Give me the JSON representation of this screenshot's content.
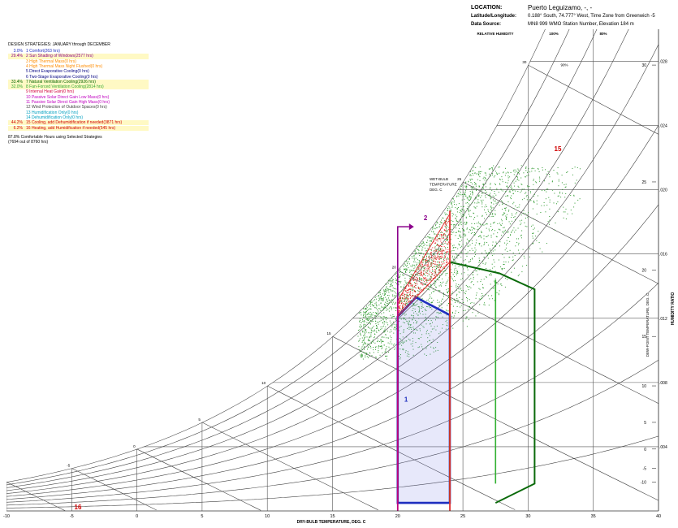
{
  "header": {
    "location_label": "LOCATION:",
    "location_value": "Puerto Leguizamo, -, -",
    "latlon_label": "Latitude/Longitude:",
    "latlon_value": "0.188° South, 74.777° West, Time Zone from Greenwich -5",
    "source_label": "Data Source:",
    "source_value": "MN8     999 WMO Station Number, Elevation 184 m"
  },
  "legend": {
    "title": "DESIGN STRATEGIES: JANUARY through DECEMBER",
    "items": [
      {
        "pct": "3.0%",
        "label": "1  Comfort(263 hrs)",
        "color": "#1f2fbf",
        "highlight": false
      },
      {
        "pct": "29.4%",
        "label": "2  Sun Shading of Windows(2577 hrs)",
        "color": "#8b008b",
        "highlight": true
      },
      {
        "pct": "",
        "label": "3  High Thermal Mass(0 hrs)",
        "color": "#ff8c00",
        "highlight": false
      },
      {
        "pct": "",
        "label": "4  High Thermal Mass Night Flushed(0 hrs)",
        "color": "#ff8c00",
        "highlight": false
      },
      {
        "pct": "",
        "label": "5  Direct Evaporative Cooling(0 hrs)",
        "color": "#000080",
        "highlight": false
      },
      {
        "pct": "",
        "label": "6  Two-Stage Evaporative Cooling(0 hrs)",
        "color": "#000080",
        "highlight": false
      },
      {
        "pct": "33.4%",
        "label": "7  Natural Ventilation Cooling(2926 hrs)",
        "color": "#006400",
        "highlight": true
      },
      {
        "pct": "32.0%",
        "label": "8  Fan-Forced Ventilation Cooling(2814 hrs)",
        "color": "#32a832",
        "highlight": true
      },
      {
        "pct": "",
        "label": "9  Internal Heat Gain(0 hrs)",
        "color": "#d2003c",
        "highlight": false
      },
      {
        "pct": "",
        "label": "10  Passive Solar Direct Gain Low Mass(0 hrs)",
        "color": "#c000c0",
        "highlight": false
      },
      {
        "pct": "",
        "label": "11  Passive Solar Direct Gain High Mass(0 hrs)",
        "color": "#c000c0",
        "highlight": false
      },
      {
        "pct": "",
        "label": "12  Wind Protection of Outdoor Spaces(0 hrs)",
        "color": "#404040",
        "highlight": false
      },
      {
        "pct": "",
        "label": "13  Humidification Only(0 hrs)",
        "color": "#00a0c0",
        "highlight": false
      },
      {
        "pct": "",
        "label": "14  Dehumidification Only(0 hrs)",
        "color": "#00a0c0",
        "highlight": false
      },
      {
        "pct": "44.2%",
        "label": "15  Cooling, add Dehumidification if needed(3871 hrs)",
        "color": "#d00000",
        "highlight": true
      },
      {
        "pct": "6.2%",
        "label": "16  Heating, add Humidification if needed(545 hrs)",
        "color": "#d00000",
        "highlight": true
      }
    ],
    "summary_line1": "87.8%  Comfortable Hours using Selected Strategies",
    "summary_line2": "(7694 out of 8760 hrs)"
  },
  "chart_data": {
    "type": "scatter",
    "xlabel": "DRY-BULB TEMPERATURE, DEG. C",
    "ylabel": "HUMIDITY RATIO",
    "y2label": "DEW-POINT TEMPERATURE, DEG. C",
    "rh_label": "RELATIVE HUMIDITY",
    "rh_top_labels": [
      "100%",
      "80%"
    ],
    "rh_curve_label": "90%",
    "wet_bulb_label": [
      "WET-BULB",
      "TEMPERATURE",
      "DEG. C"
    ],
    "xlim": [
      -10,
      40
    ],
    "ylim": [
      0,
      0.03
    ],
    "x_ticks": [
      -10,
      -5,
      0,
      5,
      10,
      15,
      20,
      25,
      30,
      35,
      40
    ],
    "y_ticks": [
      ".028",
      ".024",
      ".020",
      ".016",
      ".012",
      ".008",
      ".004"
    ],
    "dewpoint_ticks": [
      30,
      25,
      20,
      15,
      10,
      5,
      0,
      -5,
      -10
    ],
    "wet_bulb_ticks": [
      -10,
      -5,
      0,
      5,
      10,
      15,
      20,
      25,
      30
    ],
    "rh_curves": [
      10,
      20,
      30,
      40,
      50,
      60,
      70,
      80,
      90,
      100
    ],
    "zone_labels": [
      {
        "text": "1",
        "x": 20.5,
        "w": 0.0068,
        "color": "#1f2fbf"
      },
      {
        "text": "2",
        "x": 22.0,
        "w": 0.0181,
        "color": "#8b008b"
      },
      {
        "text": "15",
        "x": 32.0,
        "w": 0.0224,
        "color": "#d00000"
      },
      {
        "text": "16",
        "x": -4.8,
        "w": 0.0001,
        "color": "#d00000"
      }
    ],
    "comfort_zone": [
      [
        20,
        0.0005
      ],
      [
        20,
        0.0121
      ],
      [
        21.4,
        0.0133
      ],
      [
        24,
        0.0122
      ],
      [
        24,
        0.0005
      ]
    ],
    "natural_vent_zone": [
      [
        24,
        0.0005
      ],
      [
        24,
        0.0155
      ],
      [
        27.8,
        0.0148
      ],
      [
        30.5,
        0.0138
      ],
      [
        30.5,
        0.0017
      ],
      [
        27.5,
        0.0005
      ]
    ],
    "fan_vent_zone": [
      [
        27.5,
        0.0017
      ],
      [
        27.5,
        0.0144
      ]
    ],
    "shading_zone": [
      [
        20,
        0.0131
      ],
      [
        24,
        0.0185
      ],
      [
        24,
        0.0155
      ],
      [
        21.4,
        0.0133
      ],
      [
        20,
        0.0121
      ]
    ],
    "strategy_lines": [
      {
        "x": 20,
        "color": "#c0007a"
      },
      {
        "x": 24,
        "color": "#e03030"
      }
    ],
    "data_cloud": {
      "x_range": [
        17,
        34
      ],
      "rh_range": [
        55,
        100
      ],
      "w_range": [
        0.0095,
        0.0215
      ],
      "count": 2600
    }
  }
}
